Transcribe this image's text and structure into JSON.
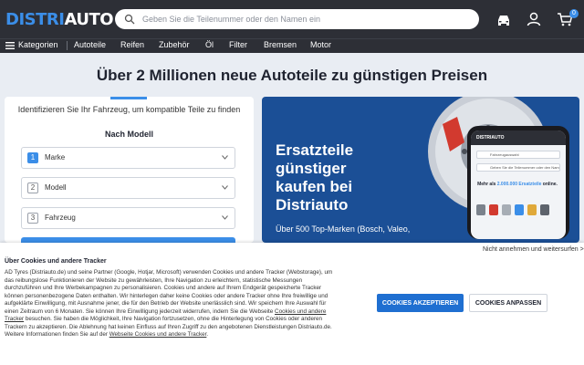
{
  "header": {
    "logo_part1": "DISTRI",
    "logo_part2": "AUTO",
    "search_placeholder": "Geben Sie die Teilenummer oder den Namen ein",
    "cart_count": "0",
    "icons": [
      "search-icon",
      "car-icon",
      "user-icon",
      "cart-icon"
    ]
  },
  "nav": {
    "categories": "Kategorien",
    "items": [
      "Autoteile",
      "Reifen",
      "Zubehör",
      "Öl",
      "Filter",
      "Bremsen",
      "Motor"
    ]
  },
  "hero": {
    "headline": "Über 2 Millionen neue Autoteile zu günstigen Preisen"
  },
  "vehicle_selector": {
    "intro": "Identifizieren Sie Ihr Fahrzeug, um kompatible Teile zu finden",
    "mode": "Nach Modell",
    "steps": [
      {
        "number": "1",
        "label": "Marke"
      },
      {
        "number": "2",
        "label": "Modell"
      },
      {
        "number": "3",
        "label": "Fahrzeug"
      }
    ]
  },
  "promo": {
    "title": "Ersatzteile günstiger kaufen bei Distriauto",
    "subtitle": "Über 500 Top-Marken (Bosch, Valeo,",
    "phone": {
      "logo": "DISTRIAUTO",
      "field1": "Fahrzeugauswahl",
      "field2": "Geben Sie die Teilenummer oder den Namen ein",
      "promo_prefix": "Mehr als ",
      "promo_highlight": "2.000.000 Ersatzteile",
      "promo_suffix": " online."
    }
  },
  "cookie": {
    "reject": "Nicht annehmen und weitersurfen >",
    "title": "Über Cookies und andere Tracker",
    "text_1": "AD Tyres (Distriauto.de) und seine Partner (Google, Hotjar, Microsoft) verwenden Cookies und andere Tracker (Webstorage), um das reibungslose Funktionieren der Website zu gewährleisten, Ihre Navigation zu erleichtern, statistische Messungen durchzuführen und Ihre Werbekampagnen zu personalisieren. Cookies und andere auf Ihrem Endgerät gespeicherte Tracker können personenbezogene Daten enthalten. Wir hinterlegen daher keine Cookies oder andere Tracker ohne Ihre freiwillige und aufgeklärte Einwilligung, mit Ausnahme jener, die für den Betrieb der Website unerlässlich sind. Wir speichern Ihre Auswahl für einen Zeitraum von 6 Monaten. Sie können Ihre Einwilligung jederzeit widerrufen, indem Sie die Webseite ",
    "link_1": "Cookies und andere Tracker",
    "text_2": " besuchen. Sie haben die Möglichkeit, Ihre Navigation fortzusetzen, ohne die Hinterlegung von Cookies oder anderen Trackern zu akzeptieren. Die Ablehnung hat keinen Einfluss auf Ihren Zugriff zu den angebotenen Dienstleistungen Distriauto.de. Weitere Informationen finden Sie auf der ",
    "link_2": "Webseite Cookies und andere Tracker",
    "text_3": ".",
    "accept": "COOKIES AKZEPTIEREN",
    "adjust": "COOKIES ANPASSEN"
  },
  "colors": {
    "header_bg": "#2d2f36",
    "accent": "#3b8ee8",
    "promo_bg": "#1b4f96",
    "accept_bg": "#1f6fd1"
  }
}
